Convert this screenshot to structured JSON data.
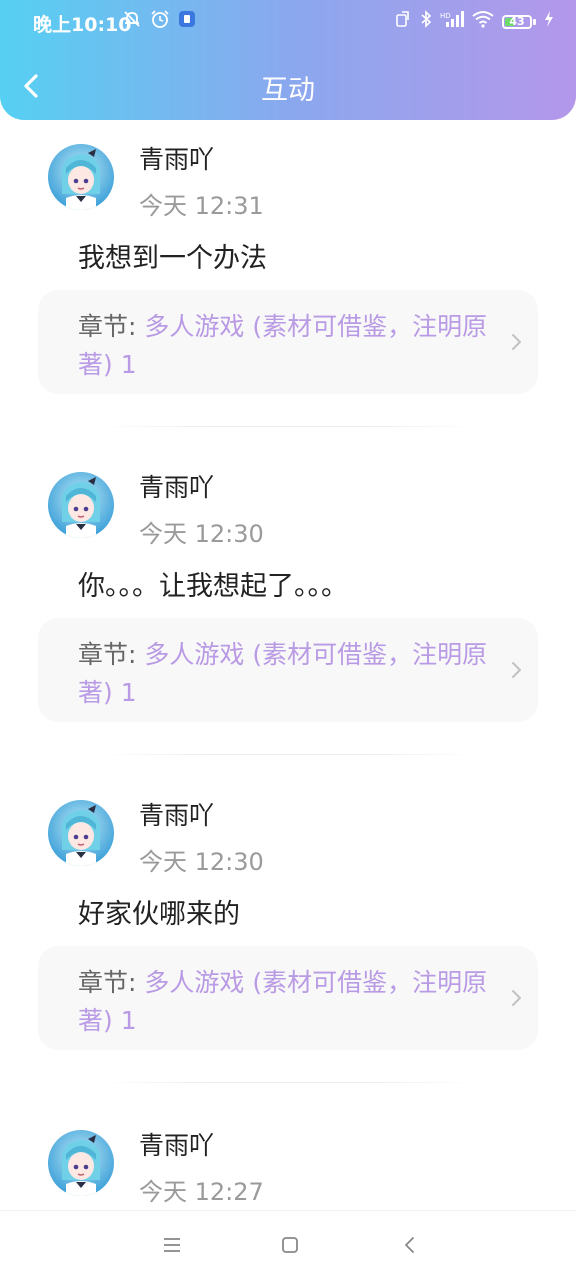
{
  "status_bar": {
    "time": "晚上10:10",
    "battery_level": "43",
    "battery_fraction": 0.43,
    "left_icons": [
      "mute-bell-icon",
      "alarm-icon",
      "app-notification-icon"
    ],
    "right_icons": [
      "screen-rotate-icon",
      "bluetooth-icon",
      "signal-hd-icon",
      "wifi-icon",
      "battery-icon",
      "charging-icon"
    ]
  },
  "header": {
    "title": "互动",
    "back_icon": "chevron-left-icon"
  },
  "colors": {
    "header_gradient_start": "#56d0f2",
    "header_gradient_end": "#b497ea",
    "chapter_link": "#b99ae4",
    "card_background": "#f8f8f8"
  },
  "interactions": [
    {
      "username": "青雨吖",
      "time": "今天 12:31",
      "content": "我想到一个办法",
      "chapter_prefix": "章节: ",
      "chapter_title": "多人游戏 (素材可借鉴，注明原著) 1"
    },
    {
      "username": "青雨吖",
      "time": "今天 12:30",
      "content": "你。。。让我想起了。。。",
      "chapter_prefix": "章节: ",
      "chapter_title": "多人游戏 (素材可借鉴，注明原著) 1"
    },
    {
      "username": "青雨吖",
      "time": "今天 12:30",
      "content": "好家伙哪来的",
      "chapter_prefix": "章节: ",
      "chapter_title": "多人游戏 (素材可借鉴，注明原著) 1"
    },
    {
      "username": "青雨吖",
      "time": "今天 12:27",
      "content": "",
      "chapter_prefix": "",
      "chapter_title": ""
    }
  ],
  "nav_bar": {
    "icons": [
      "menu-icon",
      "home-square-icon",
      "back-triangle-icon"
    ]
  }
}
